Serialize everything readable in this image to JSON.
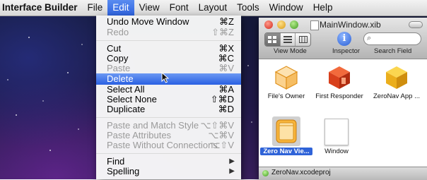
{
  "menubar": {
    "apple": "",
    "items": [
      {
        "label": "Interface Builder"
      },
      {
        "label": "File"
      },
      {
        "label": "Edit"
      },
      {
        "label": "View"
      },
      {
        "label": "Font"
      },
      {
        "label": "Layout"
      },
      {
        "label": "Tools"
      },
      {
        "label": "Window"
      },
      {
        "label": "Help"
      }
    ]
  },
  "edit_menu": {
    "items": [
      {
        "label": "Undo Move Window",
        "shortcut": "⌘Z",
        "enabled": true
      },
      {
        "label": "Redo",
        "shortcut": "⇧⌘Z",
        "enabled": false
      },
      {
        "label": "Cut",
        "shortcut": "⌘X",
        "enabled": true
      },
      {
        "label": "Copy",
        "shortcut": "⌘C",
        "enabled": true
      },
      {
        "label": "Paste",
        "shortcut": "⌘V",
        "enabled": false
      },
      {
        "label": "Delete",
        "shortcut": "",
        "enabled": true,
        "highlighted": true
      },
      {
        "label": "Select All",
        "shortcut": "⌘A",
        "enabled": true
      },
      {
        "label": "Select None",
        "shortcut": "⇧⌘D",
        "enabled": true
      },
      {
        "label": "Duplicate",
        "shortcut": "⌘D",
        "enabled": true
      },
      {
        "label": "Paste and Match Style",
        "shortcut": "⌥⇧⌘V",
        "enabled": false
      },
      {
        "label": "Paste Attributes",
        "shortcut": "⌥⌘V",
        "enabled": false
      },
      {
        "label": "Paste Without Connections",
        "shortcut": "⌥⇧V",
        "enabled": false
      },
      {
        "label": "Find",
        "shortcut": "",
        "enabled": true,
        "submenu": true
      },
      {
        "label": "Spelling",
        "shortcut": "",
        "enabled": true,
        "submenu": true
      }
    ]
  },
  "window": {
    "title": "MainWindow.xib",
    "toolbar": {
      "view_mode_label": "View Mode",
      "inspector_label": "Inspector",
      "search_label": "Search Field",
      "inspector_glyph": "i"
    },
    "objects": [
      {
        "caption": "File's Owner",
        "icon": "cube-outline-icon",
        "color": "#f0a030"
      },
      {
        "caption": "First Responder",
        "icon": "red-cube-icon",
        "color": "#c8341c"
      },
      {
        "caption": "ZeroNav App ...",
        "icon": "yellow-cube-icon",
        "color": "#e8a818"
      },
      {
        "caption": "Zero Nav Vie...",
        "icon": "view-controller-icon",
        "color": "#f0a020",
        "selected": true
      },
      {
        "caption": "Window",
        "icon": "window-icon",
        "color": "#ffffff"
      }
    ],
    "status_text": "ZeroNav.xcodeproj"
  }
}
